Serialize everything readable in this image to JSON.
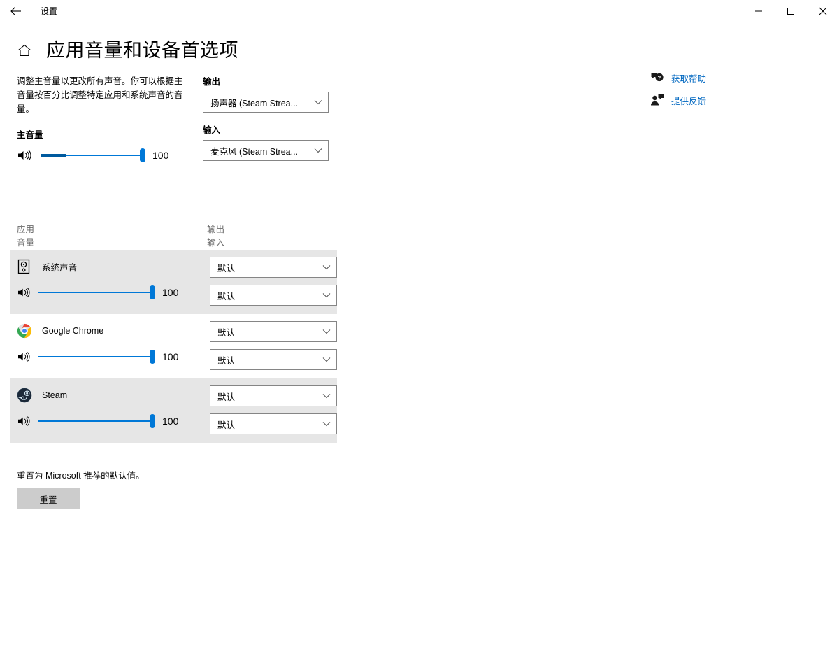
{
  "window": {
    "app_title": "设置",
    "back_icon": "back-arrow-icon",
    "minimize_icon": "minimize-icon",
    "maximize_icon": "maximize-icon",
    "close_icon": "close-icon"
  },
  "header": {
    "home_icon": "home-icon",
    "title": "应用音量和设备首选项"
  },
  "main": {
    "description": "调整主音量以更改所有声音。你可以根据主音量按百分比调整特定应用和系统声音的音量。",
    "master_volume_label": "主音量",
    "master_volume_value": "100",
    "output_label": "输出",
    "output_device": "扬声器 (Steam Strea...",
    "input_label": "输入",
    "input_device": "麦克风 (Steam Strea..."
  },
  "table": {
    "col_app": "应用",
    "col_volume": "音量",
    "col_output": "输出",
    "col_input": "输入",
    "rows": [
      {
        "name": "系统声音",
        "icon": "system-sounds-icon",
        "volume": "100",
        "output": "默认",
        "input": "默认",
        "highlighted": true
      },
      {
        "name": "Google Chrome",
        "icon": "chrome-icon",
        "volume": "100",
        "output": "默认",
        "input": "默认",
        "highlighted": false
      },
      {
        "name": "Steam",
        "icon": "steam-icon",
        "volume": "100",
        "output": "默认",
        "input": "默认",
        "highlighted": true
      }
    ]
  },
  "reset": {
    "text": "重置为 Microsoft 推荐的默认值。",
    "button_label": "重置"
  },
  "links": [
    {
      "label": "获取帮助",
      "icon": "help-icon"
    },
    {
      "label": "提供反馈",
      "icon": "feedback-icon"
    }
  ],
  "colors": {
    "accent": "#0078D7",
    "accent_dark": "#005A9E",
    "link": "#0067C0",
    "row_highlight": "#E6E6E6",
    "button_face": "#CCCCCC"
  }
}
